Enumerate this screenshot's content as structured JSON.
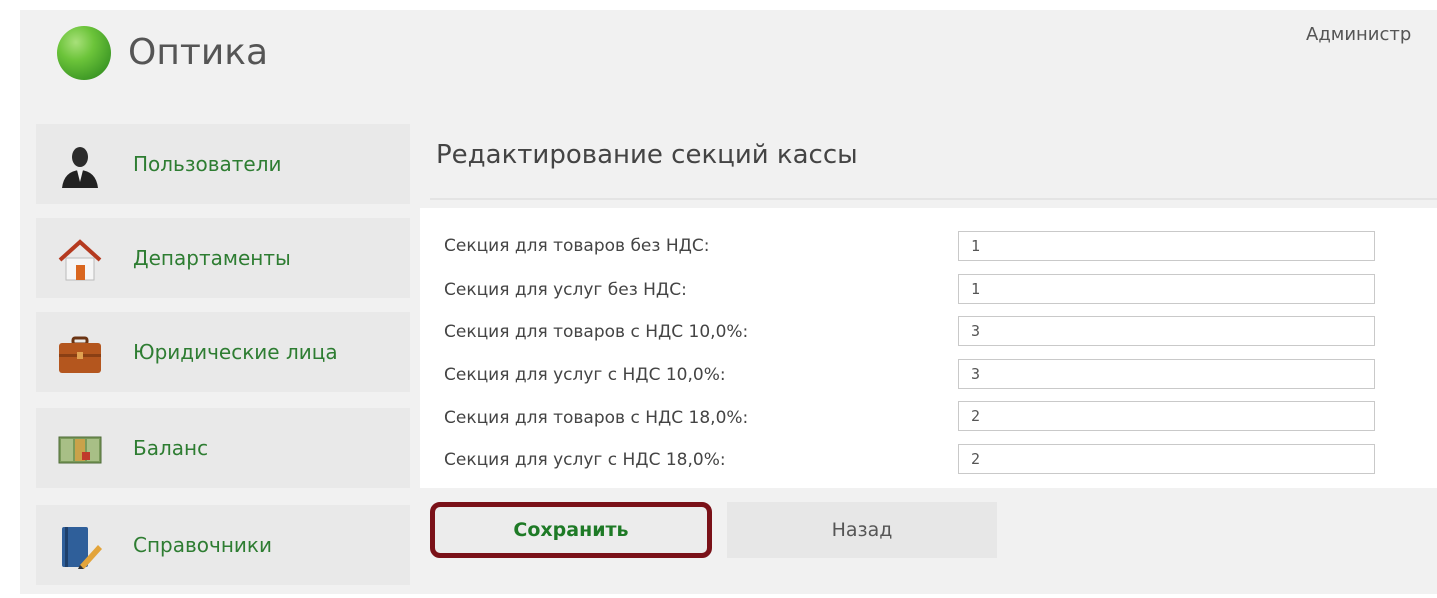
{
  "header": {
    "app_title": "Оптика",
    "user_link": "Администр"
  },
  "sidebar": {
    "items": [
      {
        "label": "Пользователи",
        "icon": "user-icon"
      },
      {
        "label": "Департаменты",
        "icon": "house-icon"
      },
      {
        "label": "Юридические лица",
        "icon": "briefcase-icon"
      },
      {
        "label": "Баланс",
        "icon": "money-icon"
      },
      {
        "label": "Справочники",
        "icon": "book-pencil-icon"
      }
    ]
  },
  "main": {
    "title": "Редактирование секций кассы",
    "fields": [
      {
        "label": "Секция для товаров без НДС:",
        "value": "1"
      },
      {
        "label": "Секция для услуг без НДС:",
        "value": "1"
      },
      {
        "label": "Секция для товаров с НДС 10,0%:",
        "value": "3"
      },
      {
        "label": "Секция для услуг с НДС 10,0%:",
        "value": "3"
      },
      {
        "label": "Секция для товаров с НДС 18,0%:",
        "value": "2"
      },
      {
        "label": "Секция для услуг с НДС 18,0%:",
        "value": "2"
      }
    ],
    "save_label": "Сохранить",
    "back_label": "Назад"
  },
  "colors": {
    "accent_green": "#2e7d32",
    "highlight_border": "#7a1118"
  }
}
